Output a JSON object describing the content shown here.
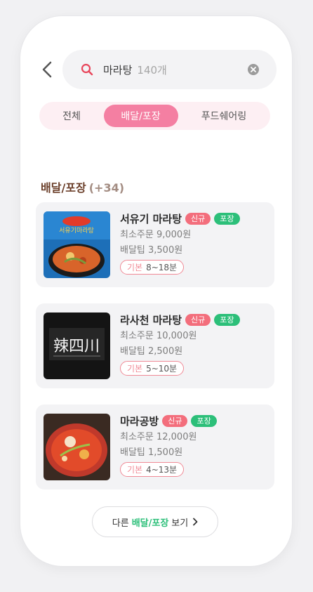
{
  "search": {
    "query": "마라탕",
    "count": "140개"
  },
  "tabs": [
    {
      "label": "전체",
      "active": false
    },
    {
      "label": "배달/포장",
      "active": true
    },
    {
      "label": "푸드쉐어링",
      "active": false
    }
  ],
  "section": {
    "title": "배달/포장",
    "extra": "(+34)"
  },
  "restaurants": [
    {
      "name": "서유기 마라탕",
      "badges": [
        "신규",
        "포장"
      ],
      "min_order": "최소주문 9,000원",
      "delivery_tip": "배달팁 3,500원",
      "time_label": "기본",
      "time_value": "8~18분",
      "thumb_text": "서유기마라탕"
    },
    {
      "name": "라사천 마라탕",
      "badges": [
        "신규",
        "포장"
      ],
      "min_order": "최소주문 10,000원",
      "delivery_tip": "배달팁 2,500원",
      "time_label": "기본",
      "time_value": "5~10분",
      "thumb_text": "辣四川"
    },
    {
      "name": "마라공방",
      "badges": [
        "신규",
        "포장"
      ],
      "min_order": "최소주문 12,000원",
      "delivery_tip": "배달팁 1,500원",
      "time_label": "기본",
      "time_value": "4~13분"
    }
  ],
  "more_button": {
    "prefix": "다른",
    "highlight": "배달/포장",
    "suffix": "보기"
  },
  "colors": {
    "accent_pink": "#f47fa2",
    "badge_new": "#f36e7c",
    "badge_pack": "#2cbf79",
    "search_icon": "#e8455a"
  },
  "icons": {
    "back": "chevron-left-icon",
    "search": "search-icon",
    "clear": "clear-icon",
    "more": "chevron-right-icon"
  }
}
